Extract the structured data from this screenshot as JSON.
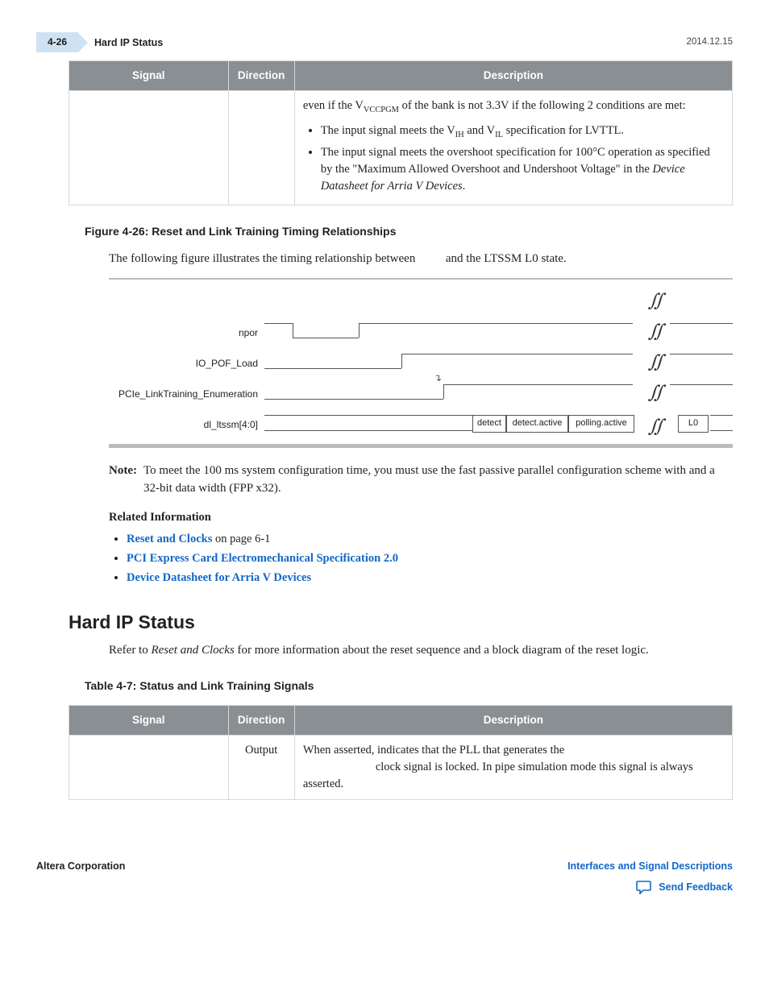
{
  "header": {
    "page_num": "4-26",
    "title": "Hard IP Status",
    "date": "2014.12.15"
  },
  "table1": {
    "headers": {
      "signal": "Signal",
      "direction": "Direction",
      "description": "Description"
    },
    "row": {
      "desc_intro_pre": "even if the V",
      "desc_intro_sub": "VCCPGM",
      "desc_intro_post": " of the bank is not 3.3V if the following 2 conditions are met:",
      "bullet1_pre": "The input signal meets the V",
      "bullet1_sub1": "IH",
      "bullet1_mid": " and V",
      "bullet1_sub2": "IL",
      "bullet1_post": " specification for LVTTL.",
      "bullet2_pre": "The input signal meets the overshoot specification for 100°C operation as specified by the \"Maximum Allowed Overshoot and Undershoot Voltage\" in the ",
      "bullet2_ital": "Device Datasheet for Arria V Devices",
      "bullet2_post": "."
    }
  },
  "figure": {
    "caption": "Figure 4-26: Reset and Link Training Timing Relationships",
    "intro_pre": "The following figure illustrates the timing relationship between ",
    "intro_post": " and the LTSSM L0 state.",
    "signals": {
      "s1": "npor",
      "s2": "IO_POF_Load",
      "s3": "PCIe_LinkTraining_Enumeration",
      "s4": "dl_ltssm[4:0]"
    },
    "states": {
      "st1": "detect",
      "st2": "detect.active",
      "st3": "polling.active",
      "st4": "L0"
    }
  },
  "note": {
    "label": "Note:",
    "text": "To meet the 100 ms system configuration time, you must use the fast passive parallel configuration scheme with and a 32-bit data width (FPP x32)."
  },
  "related": {
    "head": "Related Information",
    "l1_link": "Reset and Clocks",
    "l1_tail": " on page 6-1",
    "l2": "PCI Express Card Electromechanical Specification 2.0",
    "l3": "Device Datasheet for Arria V Devices"
  },
  "section2": {
    "title": "Hard IP Status",
    "para_pre": "Refer to ",
    "para_ital": "Reset and Clocks",
    "para_post": " for more information about the reset sequence and a block diagram of the reset logic."
  },
  "table2": {
    "caption": "Table 4-7: Status and Link Training Signals",
    "headers": {
      "signal": "Signal",
      "direction": "Direction",
      "description": "Description"
    },
    "row": {
      "direction": "Output",
      "desc_line1": "When asserted, indicates that the PLL that generates the",
      "desc_line2": "clock signal is locked. In pipe simulation mode this signal is always asserted."
    }
  },
  "footer": {
    "left": "Altera Corporation",
    "right_link": "Interfaces and Signal Descriptions",
    "feedback": "Send Feedback"
  }
}
